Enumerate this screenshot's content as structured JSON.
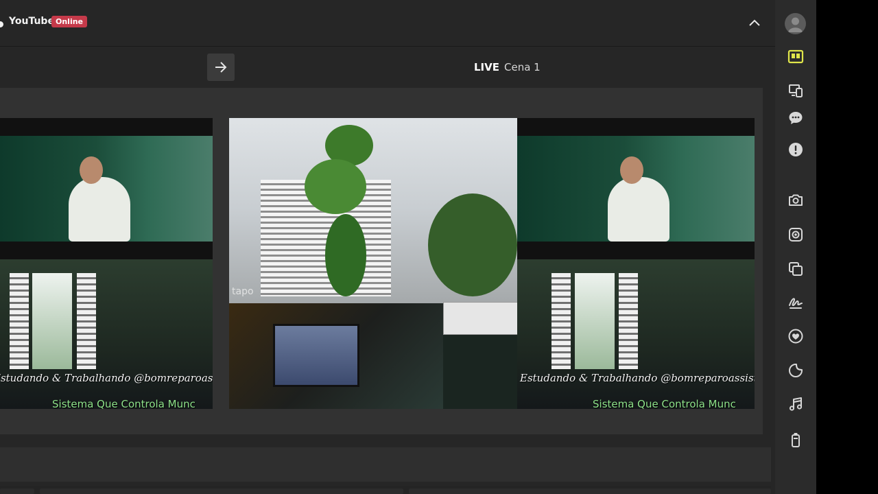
{
  "header": {
    "title": "YouTube",
    "status_badge": "Online"
  },
  "toolbar": {
    "live_label": "LIVE",
    "scene_name": "Cena 1"
  },
  "preview": {
    "overlay_handle": "Estudando & Trabalhando @bomreparoassistenc",
    "overlay_ticker": "Sistema Que Controla Munc",
    "camera_watermark": "tapo"
  },
  "sidebar": {
    "items": [
      {
        "icon": "avatar-icon"
      },
      {
        "icon": "layout-icon",
        "active": true
      },
      {
        "icon": "devices-icon"
      },
      {
        "icon": "chat-icon"
      },
      {
        "icon": "alert-icon"
      },
      {
        "icon": "camera-icon"
      },
      {
        "icon": "camera-ring-icon"
      },
      {
        "icon": "layers-icon"
      },
      {
        "icon": "signature-icon"
      },
      {
        "icon": "heart-icon"
      },
      {
        "icon": "sticker-icon"
      },
      {
        "icon": "music-icon"
      },
      {
        "icon": "battery-icon"
      }
    ]
  },
  "colors": {
    "badge": "#c53a4a",
    "active_icon": "#e0e64a",
    "icon": "#d8d8d8"
  }
}
